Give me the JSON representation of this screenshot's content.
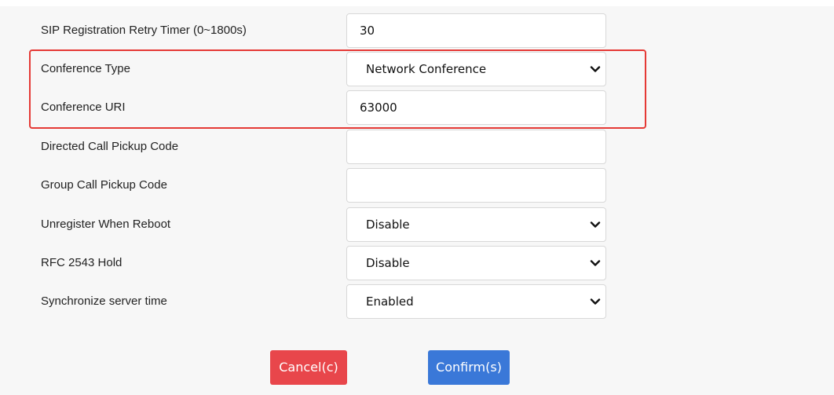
{
  "rows": [
    {
      "label": "SIP Registration Retry Timer (0~1800s)",
      "type": "text",
      "value": "30"
    },
    {
      "label": "Conference Type",
      "type": "select",
      "value": "Network Conference"
    },
    {
      "label": "Conference URI",
      "type": "text",
      "value": "63000"
    },
    {
      "label": "Directed Call Pickup Code",
      "type": "text",
      "value": ""
    },
    {
      "label": "Group Call Pickup Code",
      "type": "text",
      "value": ""
    },
    {
      "label": "Unregister When Reboot",
      "type": "select",
      "value": "Disable"
    },
    {
      "label": "RFC 2543 Hold",
      "type": "select",
      "value": "Disable"
    },
    {
      "label": "Synchronize server time",
      "type": "select",
      "value": "Enabled"
    }
  ],
  "buttons": {
    "cancel": "Cancel(c)",
    "confirm": "Confirm(s)"
  },
  "colors": {
    "highlight": "#e53935",
    "cancel": "#e8464b",
    "confirm": "#3a78d8"
  },
  "icons": {
    "select_arrow": "chevron-down-icon"
  }
}
